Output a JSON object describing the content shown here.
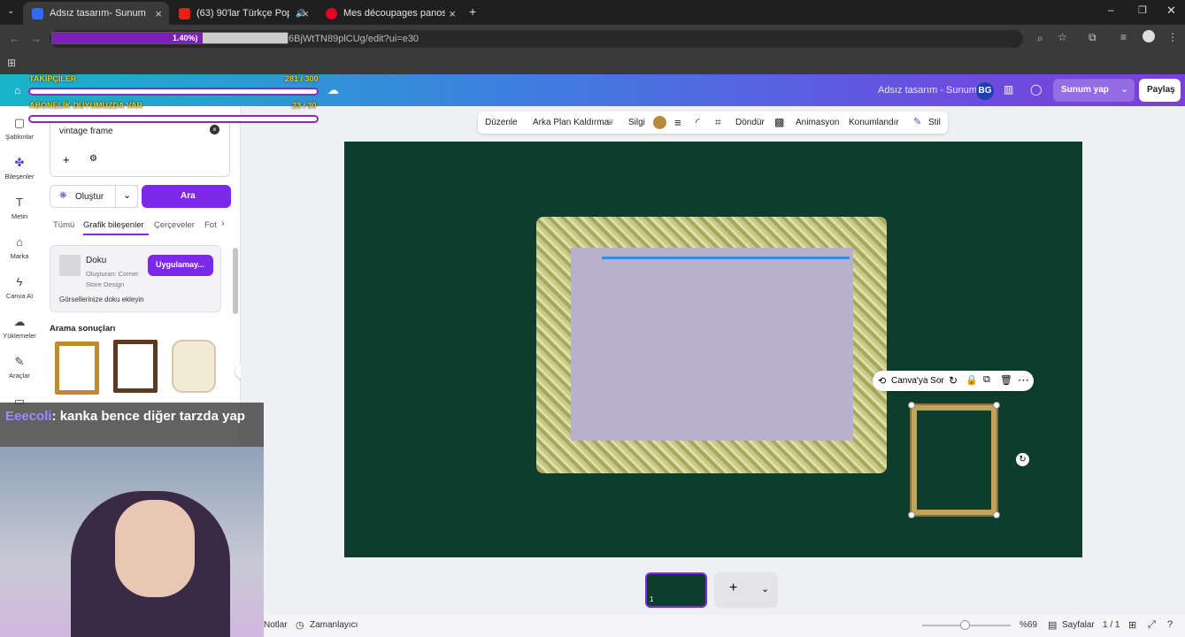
{
  "browser": {
    "tabs": [
      {
        "title": "Adsız tasarım- Sunum",
        "active": true
      },
      {
        "title": "(63) 90'lar Türkçe Pop Hareke",
        "active": false
      },
      {
        "title": "Mes découpages panosundaki",
        "active": false
      }
    ],
    "url": "6BjWtTN89plCUg/edit?ui=e30"
  },
  "stream_overlay": {
    "progress_percent_label": "1.40%)",
    "progress_fill_fraction": 0.64,
    "label_left": "TAKİPÇİLER",
    "counter_left": "281 / 300",
    "label_left2": "ABONELİK DUYUMUZDA VAR",
    "counter_left2": "23 / 30"
  },
  "canva_header": {
    "doc_title": "Adsız tasarım - Sunum",
    "avatar_initials": "BG",
    "present_label": "Sunum yap",
    "share_label": "Paylaş"
  },
  "rail": [
    {
      "label": "Şablonlar",
      "icon": "template-icon"
    },
    {
      "label": "Bileşenler",
      "icon": "elements-icon"
    },
    {
      "label": "Metin",
      "icon": "text-icon"
    },
    {
      "label": "Marka",
      "icon": "brand-icon"
    },
    {
      "label": "Canva AI",
      "icon": "ai-icon"
    },
    {
      "label": "Yüklemeler",
      "icon": "upload-icon"
    },
    {
      "label": "Araçlar",
      "icon": "tools-icon"
    }
  ],
  "panel": {
    "search_value": "vintage frame",
    "create_label": "Oluştur",
    "search_button": "Ara",
    "tabs": [
      "Tümü",
      "Grafik bileşenler",
      "Çerçeveler",
      "Fot"
    ],
    "doku": {
      "title": "Doku",
      "author": "Oluşturan: Corner Store Design",
      "apply_label": "Uygulamay...",
      "hint": "Görsellerinize doku ekleyin"
    },
    "results_heading": "Arama sonuçları"
  },
  "toolbar": {
    "items": [
      "Düzenle",
      "Arka Plan Kaldırma",
      "Silgi",
      "Döndür",
      "Animasyon",
      "Konumlandır",
      "Stil"
    ],
    "color": "#b58a3a"
  },
  "context_menu": {
    "ask_label": "Canva'ya Sor"
  },
  "bottom_bar": {
    "notes": "Notlar",
    "timer": "Zamanlayıcı",
    "zoom": "%69",
    "pages_label": "Sayfalar",
    "page_count": "1 / 1",
    "page_number": "1",
    "zoom_fraction": 0.48
  },
  "chat": {
    "username": "Eeecoli",
    "message": ": kanka bence diğer tarzda yap"
  }
}
